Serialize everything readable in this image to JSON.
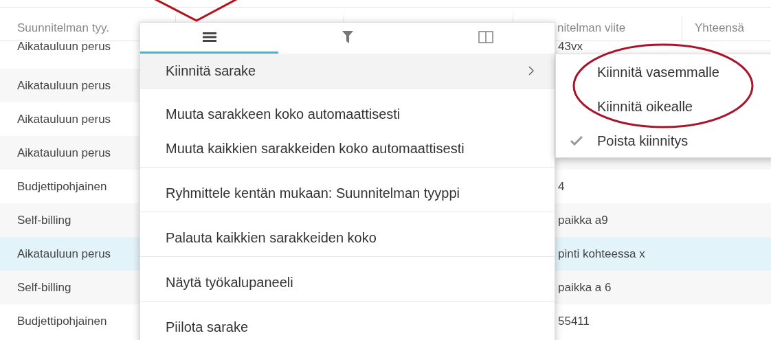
{
  "table": {
    "columns": [
      {
        "label": "Suunnitelman tyy."
      },
      {
        "label": "nitelman viite"
      },
      {
        "label": "Yhteensä"
      }
    ],
    "rows": [
      {
        "cells": [
          "Aikatauluun perus",
          "43vx"
        ],
        "selected": false
      },
      {
        "cells": [
          "Aikatauluun perus",
          ""
        ],
        "selected": false
      },
      {
        "cells": [
          "Aikatauluun perus",
          ""
        ],
        "selected": false
      },
      {
        "cells": [
          "Aikatauluun perus",
          ""
        ],
        "selected": false
      },
      {
        "cells": [
          "Budjettipohjainen",
          "4"
        ],
        "selected": false
      },
      {
        "cells": [
          "Self-billing",
          "paikka a9"
        ],
        "selected": false
      },
      {
        "cells": [
          "Aikatauluun perus",
          "pinti kohteessa x"
        ],
        "selected": true
      },
      {
        "cells": [
          "Self-billing",
          "paikka a 6"
        ],
        "selected": false
      },
      {
        "cells": [
          "Budjettipohjainen",
          "55411"
        ],
        "selected": false
      }
    ]
  },
  "column_menu": {
    "tabs": [
      {
        "kind": "menu",
        "selected": true
      },
      {
        "kind": "filter",
        "selected": false
      },
      {
        "kind": "columns",
        "selected": false
      }
    ],
    "sections": [
      [
        {
          "label": "Kiinnitä sarake",
          "highlighted": true,
          "submenu": true
        }
      ],
      [
        {
          "label": "Muuta sarakkeen koko automaattisesti",
          "highlighted": false,
          "submenu": false
        },
        {
          "label": "Muuta kaikkien sarakkeiden koko automaattisesti",
          "highlighted": false,
          "submenu": false
        }
      ],
      [
        {
          "label": "Ryhmittele kentän mukaan: Suunnitelman tyyppi",
          "highlighted": false,
          "submenu": false
        }
      ],
      [
        {
          "label": "Palauta kaikkien sarakkeiden koko",
          "highlighted": false,
          "submenu": false
        }
      ],
      [
        {
          "label": "Näytä työkalupaneeli",
          "highlighted": false,
          "submenu": false
        }
      ],
      [
        {
          "label": "Piilota sarake",
          "highlighted": false,
          "submenu": false
        }
      ]
    ],
    "submenu": [
      {
        "label": "Kiinnitä vasemmalle",
        "checked": false
      },
      {
        "label": "Kiinnitä oikealle",
        "checked": false
      },
      {
        "label": "Poista kiinnitys",
        "checked": true
      }
    ]
  }
}
